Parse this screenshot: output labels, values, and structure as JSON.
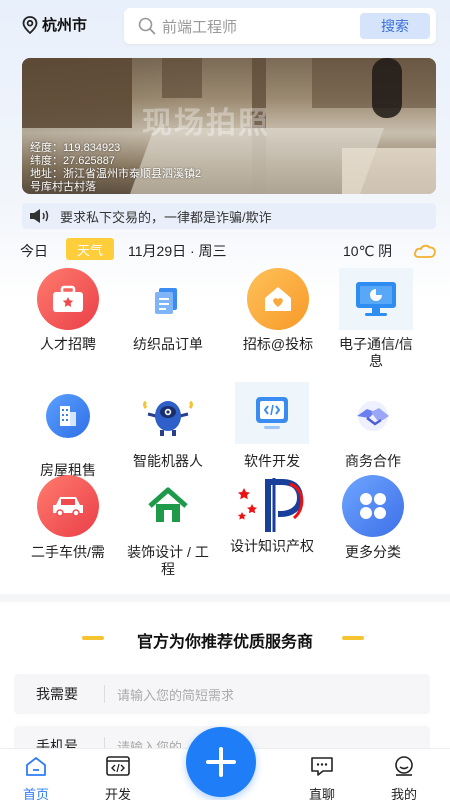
{
  "header": {
    "location": "杭州市",
    "search_placeholder": "前端工程师",
    "search_button": "搜索"
  },
  "banner": {
    "watermark": "现场拍照",
    "longitude": "经度：119.834923",
    "latitude": "纬度：27.625887",
    "address": "地址：浙江省温州市泰顺县泗溪镇2",
    "address2": "号库村古村落"
  },
  "notice": {
    "text": "要求私下交易的，一律都是诈骗/欺诈"
  },
  "date_row": {
    "today": "今日",
    "weather_tag": "天气",
    "date": "11月29日 · 周三",
    "temperature": "10℃ 阴"
  },
  "categories": [
    {
      "label": "人才招聘",
      "icon": "briefcase-icon",
      "color": "#f0585a"
    },
    {
      "label": "纺织品订单",
      "icon": "document-icon",
      "color": "#3b8cf0"
    },
    {
      "label": "招标@投标",
      "icon": "house-heart-icon",
      "color": "#f9a83a"
    },
    {
      "label": "电子通信/信息",
      "icon": "monitor-icon",
      "color": "#2f8cf0"
    },
    {
      "label": "房屋租售",
      "icon": "building-icon",
      "color": "#3b7ff0"
    },
    {
      "label": "智能机器人",
      "icon": "robot-icon",
      "color": "#3a6fd8"
    },
    {
      "label": "软件开发",
      "icon": "code-icon",
      "color": "#3b8cf0"
    },
    {
      "label": "商务合作",
      "icon": "handshake-icon",
      "color": "#6a7ff0"
    },
    {
      "label": "二手车供/需",
      "icon": "car-icon",
      "color": "#f0585a"
    },
    {
      "label": "装饰设计 / 工程",
      "icon": "home-icon",
      "color": "#1f9a4a"
    },
    {
      "label": "设计知识产权",
      "icon": "ip-logo-icon",
      "color": "#1a3f9a"
    },
    {
      "label": "更多分类",
      "icon": "grid-icon",
      "color": "#4a7ff0"
    }
  ],
  "section": {
    "title": "官方为你推荐优质服务商",
    "fields": [
      {
        "label": "我需要",
        "placeholder": "请输入您的简短需求"
      },
      {
        "label": "手机号",
        "placeholder": "请输入您的"
      }
    ]
  },
  "tabbar": {
    "items": [
      {
        "label": "首页",
        "icon": "home-tab-icon"
      },
      {
        "label": "开发",
        "icon": "code-tab-icon"
      },
      {
        "label": "直聊",
        "icon": "chat-tab-icon"
      },
      {
        "label": "我的",
        "icon": "profile-tab-icon"
      }
    ],
    "fab_icon": "plus-icon"
  },
  "colors": {
    "accent": "#2f7cf6",
    "fab": "#1f7ef7",
    "notice_bg": "#e9effa",
    "weather_tag": "#ffce3a"
  }
}
